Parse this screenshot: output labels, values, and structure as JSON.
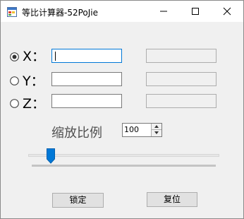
{
  "window": {
    "title": "等比计算器-52PoJie"
  },
  "rows": [
    {
      "axis": "X：",
      "selected": true,
      "input": "",
      "output": ""
    },
    {
      "axis": "Y：",
      "selected": false,
      "input": "",
      "output": ""
    },
    {
      "axis": "Z：",
      "selected": false,
      "input": "",
      "output": ""
    }
  ],
  "scale": {
    "label": "缩放比例",
    "value": "100"
  },
  "slider": {
    "level_fraction": 0.1
  },
  "buttons": {
    "lock_label": "锁定",
    "reset_label": "复位"
  },
  "colors": {
    "focus_border": "#0078d7",
    "slider_thumb": "#0078d7",
    "background": "#f0f0f0"
  },
  "icons": {
    "app": "app-window-icon",
    "minimize": "minimize-icon",
    "maximize": "maximize-icon",
    "close": "close-icon"
  }
}
